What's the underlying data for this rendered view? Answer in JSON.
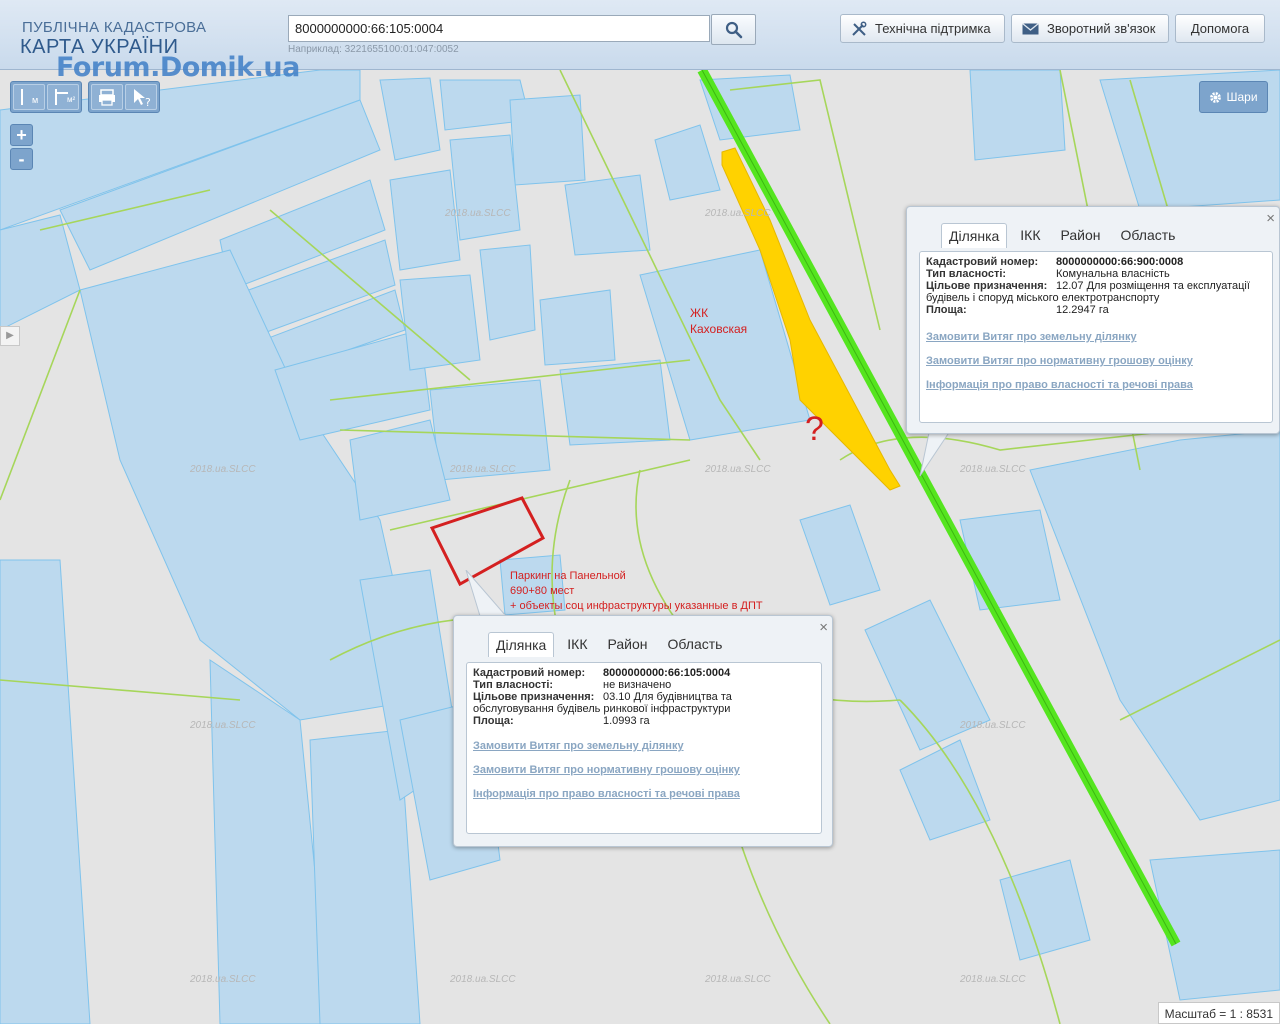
{
  "header": {
    "logo_line1": "ПУБЛІЧНА КАДАСТРОВА",
    "logo_line2": "КАРТА УКРАЇНИ",
    "watermark": "Forum.Domik.ua",
    "search_value": "8000000000:66:105:0004",
    "search_hint": "Наприклад: 3221655100:01:047:0052",
    "buttons": {
      "support": "Технічна підтримка",
      "feedback": "Зворотний зв'язок",
      "help": "Допомога"
    }
  },
  "toolbar": {
    "zoom_in": "+",
    "zoom_out": "-",
    "layers_label": "Шари",
    "measure_unit_m": "м",
    "measure_unit_m2": "м²"
  },
  "map_labels": {
    "zhk_line1": "ЖК",
    "zhk_line2": "Каховская",
    "question": "?",
    "parking_line1": "Паркинг на Панельной",
    "parking_line2": "690+80 мест",
    "parking_line3": "+ объекты соц инфраструктуры указанные в ДПТ",
    "slcc": "2018.ua.SLCC"
  },
  "popup_top": {
    "tabs": [
      "Ділянка",
      "ІКК",
      "Район",
      "Область"
    ],
    "fields": {
      "cadastral_label": "Кадастровий номер:",
      "cadastral_value": "8000000000:66:900:0008",
      "ownership_label": "Тип власності:",
      "ownership_value": "Комунальна власність",
      "purpose_label": "Цільове призначення:",
      "purpose_value_line1": "12.07 Для розміщення та експлуатації",
      "purpose_value_line2": "будівель і споруд міського електротранспорту",
      "area_label": "Площа:",
      "area_value": "12.2947 га"
    },
    "links": [
      "Замовити Витяг про земельну ділянку",
      "Замовити Витяг про нормативну грошову оцінку",
      "Інформація про право власності та речові права"
    ]
  },
  "popup_bottom": {
    "tabs": [
      "Ділянка",
      "ІКК",
      "Район",
      "Область"
    ],
    "fields": {
      "cadastral_label": "Кадастровий номер:",
      "cadastral_value": "8000000000:66:105:0004",
      "ownership_label": "Тип власності:",
      "ownership_value": "не визначено",
      "purpose_label": "Цільове призначення:",
      "purpose_value_line1": "03.10 Для будівництва та",
      "purpose_value_line2": "обслуговування будівель ринкової інфраструктури",
      "area_label": "Площа:",
      "area_value": "1.0993 га"
    },
    "links": [
      "Замовити Витяг про земельну ділянку",
      "Замовити Витяг про нормативну грошову оцінку",
      "Інформація про право власності та речові права"
    ]
  },
  "scale": "Масштаб = 1 : 8531",
  "close_symbol": "×",
  "colors": {
    "parcel_fill": "#bcd9ee",
    "parcel_stroke": "#7fc3ec",
    "boundary_green": "#a6d65a",
    "rail_green": "#55e51f",
    "highlight_yellow": "#ffd200",
    "highlight_red": "#d42020"
  }
}
